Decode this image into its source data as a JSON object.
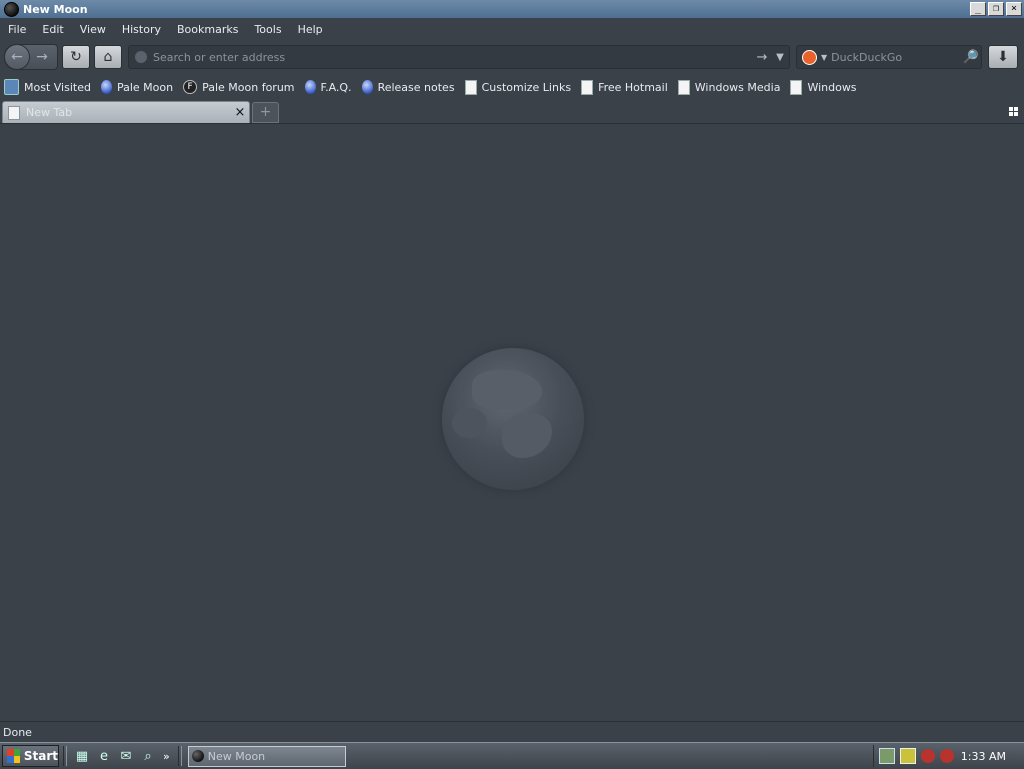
{
  "window": {
    "title": "New Moon",
    "minimize_label": "_",
    "restore_label": "❐",
    "close_label": "×"
  },
  "menubar": {
    "items": [
      "File",
      "Edit",
      "View",
      "History",
      "Bookmarks",
      "Tools",
      "Help"
    ]
  },
  "navbar": {
    "back_glyph": "←",
    "forward_glyph": "→",
    "reload_glyph": "↻",
    "home_glyph": "⌂",
    "address_placeholder": "Search or enter address",
    "go_glyph": "→",
    "dropdown_glyph": "▼",
    "search_engine": "DuckDuckGo",
    "search_go_glyph": "🔎",
    "download_glyph": "⬇"
  },
  "bookmarks": {
    "items": [
      {
        "label": "Most Visited",
        "icon": "most-visited-icon"
      },
      {
        "label": "Pale Moon",
        "icon": "pale-moon-icon"
      },
      {
        "label": "Pale Moon forum",
        "icon": "forum-icon"
      },
      {
        "label": "F.A.Q.",
        "icon": "pale-moon-icon"
      },
      {
        "label": "Release notes",
        "icon": "pale-moon-icon"
      },
      {
        "label": "Customize Links",
        "icon": "page-icon"
      },
      {
        "label": "Free Hotmail",
        "icon": "page-icon"
      },
      {
        "label": "Windows Media",
        "icon": "page-icon"
      },
      {
        "label": "Windows",
        "icon": "page-icon"
      }
    ]
  },
  "tabs": {
    "items": [
      {
        "label": "New Tab",
        "active": true
      }
    ],
    "close_glyph": "×",
    "new_tab_glyph": "+"
  },
  "status": {
    "text": "Done"
  },
  "taskbar": {
    "start_label": "Start",
    "more_glyph": "»",
    "task_label": "New Moon",
    "clock": "1:33 AM"
  }
}
